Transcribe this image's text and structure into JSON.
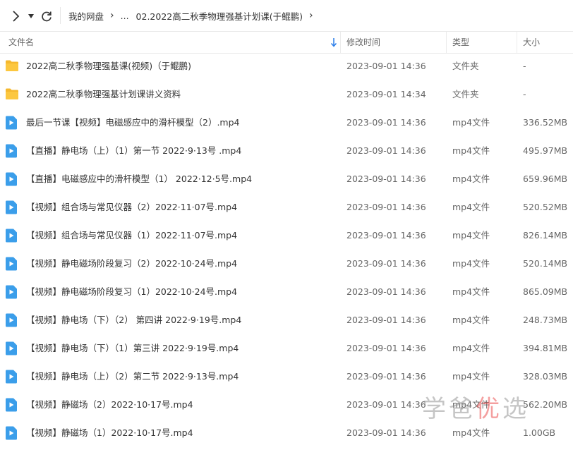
{
  "nav": {
    "forward_icon": "chevron-right-icon",
    "dropdown_icon": "caret-down-icon",
    "refresh_icon": "refresh-icon"
  },
  "breadcrumb": {
    "root": "我的网盘",
    "ellipsis": "...",
    "current": "02.2022高二秋季物理强基计划课(于鲲鹏)"
  },
  "columns": {
    "name": "文件名",
    "modified": "修改时间",
    "type": "类型",
    "size": "大小"
  },
  "colors": {
    "folder": "#f5b82e",
    "video": "#3b9eea",
    "watermark_accent": "#eb5050"
  },
  "files": [
    {
      "name": "2022高二秋季物理强基课(视频)（于鲲鹏)",
      "date": "2023-09-01 14:36",
      "type": "文件夹",
      "size": "-",
      "icon": "folder-icon"
    },
    {
      "name": "2022高二秋季物理强基计划课讲义资料",
      "date": "2023-09-01 14:34",
      "type": "文件夹",
      "size": "-",
      "icon": "folder-icon"
    },
    {
      "name": "最后一节课【视频】电磁感应中的滑杆模型（2）.mp4",
      "date": "2023-09-01 14:36",
      "type": "mp4文件",
      "size": "336.52MB",
      "icon": "video-icon"
    },
    {
      "name": "【直播】静电场（上）（1）第一节  2022·9·13号 .mp4",
      "date": "2023-09-01 14:36",
      "type": "mp4文件",
      "size": "495.97MB",
      "icon": "video-icon"
    },
    {
      "name": "【直播】电磁感应中的滑杆模型（1）  2022·12·5号.mp4",
      "date": "2023-09-01 14:36",
      "type": "mp4文件",
      "size": "659.96MB",
      "icon": "video-icon"
    },
    {
      "name": "【视频】组合场与常见仪器（2）2022·11·07号.mp4",
      "date": "2023-09-01 14:36",
      "type": "mp4文件",
      "size": "520.52MB",
      "icon": "video-icon"
    },
    {
      "name": "【视频】组合场与常见仪器（1）2022·11·07号.mp4",
      "date": "2023-09-01 14:36",
      "type": "mp4文件",
      "size": "826.14MB",
      "icon": "video-icon"
    },
    {
      "name": "【视频】静电磁场阶段复习（2）2022·10·24号.mp4",
      "date": "2023-09-01 14:36",
      "type": "mp4文件",
      "size": "520.14MB",
      "icon": "video-icon"
    },
    {
      "name": "【视频】静电磁场阶段复习（1）2022·10·24号.mp4",
      "date": "2023-09-01 14:36",
      "type": "mp4文件",
      "size": "865.09MB",
      "icon": "video-icon"
    },
    {
      "name": "【视频】静电场（下）（2） 第四讲 2022·9·19号.mp4",
      "date": "2023-09-01 14:36",
      "type": "mp4文件",
      "size": "248.73MB",
      "icon": "video-icon"
    },
    {
      "name": "【视频】静电场（下）（1）第三讲 2022·9·19号.mp4",
      "date": "2023-09-01 14:36",
      "type": "mp4文件",
      "size": "394.81MB",
      "icon": "video-icon"
    },
    {
      "name": "【视频】静电场（上）（2）第二节  2022·9·13号.mp4",
      "date": "2023-09-01 14:36",
      "type": "mp4文件",
      "size": "328.03MB",
      "icon": "video-icon"
    },
    {
      "name": "【视频】静磁场（2）2022·10·17号.mp4",
      "date": "2023-09-01 14:36",
      "type": "mp4文件",
      "size": "562.20MB",
      "icon": "video-icon"
    },
    {
      "name": "【视频】静磁场（1）2022·10·17号.mp4",
      "date": "2023-09-01 14:36",
      "type": "mp4文件",
      "size": "1.00GB",
      "icon": "video-icon"
    }
  ],
  "watermark": {
    "text_a": "学爸",
    "text_b": "优",
    "text_c": "选"
  }
}
